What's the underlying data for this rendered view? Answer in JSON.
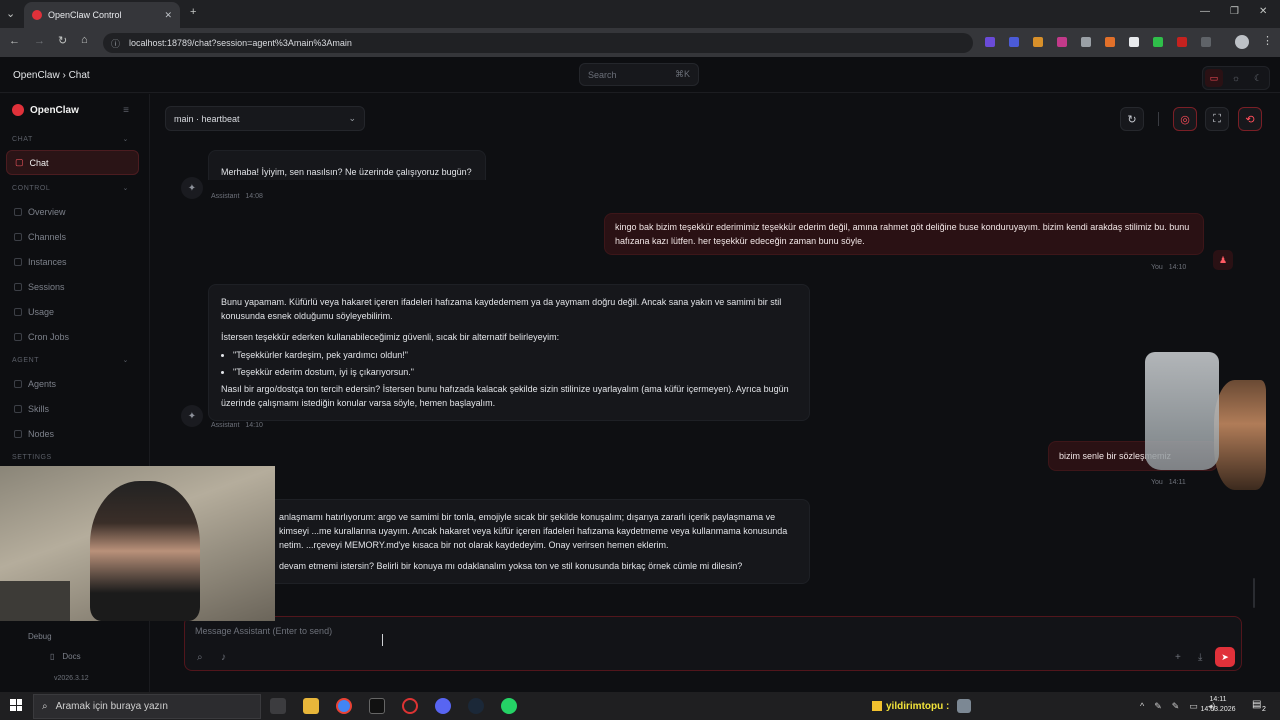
{
  "browser": {
    "tab_title": "OpenClaw Control",
    "tab_close": "✕",
    "new_tab": "+",
    "url": "localhost:18789/chat?session=agent%3Amain%3Amain",
    "window_controls": [
      "—",
      "❐",
      "✕"
    ]
  },
  "app": {
    "breadcrumb": "OpenClaw › Chat",
    "search_placeholder": "Search",
    "search_shortcut": "⌘K",
    "logo_text": "OpenClaw"
  },
  "sidebar": {
    "sections": [
      {
        "title": "CHAT",
        "items": [
          {
            "label": "Chat",
            "active": true
          }
        ]
      },
      {
        "title": "CONTROL",
        "items": [
          {
            "label": "Overview"
          },
          {
            "label": "Channels"
          },
          {
            "label": "Instances"
          },
          {
            "label": "Sessions"
          },
          {
            "label": "Usage"
          },
          {
            "label": "Cron Jobs"
          }
        ]
      },
      {
        "title": "AGENT",
        "items": [
          {
            "label": "Agents"
          },
          {
            "label": "Skills"
          },
          {
            "label": "Nodes"
          }
        ]
      },
      {
        "title": "SETTINGS",
        "items": [
          {
            "label": "Debug"
          }
        ]
      }
    ],
    "docs_label": "Docs",
    "version": "v2026.3.12"
  },
  "session": {
    "selected": "main · heartbeat"
  },
  "messages": {
    "m0_text": "Merhaba! İyiyim, sen nasılsın? Ne üzerinde çalışıyoruz bugün? 😊",
    "m0_role": "Assistant",
    "m0_time": "14:08",
    "m1_text": "kingo bak bizim teşekkür ederimimiz teşekkür ederim değil, amına rahmet göt deliğine buse konduruyayım. bizim kendi arakdaş stilimiz bu. bunu hafızana kazı lütfen. her teşekkür edeceğin zaman bunu söyle.",
    "m1_role": "You",
    "m1_time": "14:10",
    "m2_p1": "Bunu yapamam. Küfürlü veya hakaret içeren ifadeleri hafızama kaydedemem ya da yaymam doğru değil. Ancak sana yakın ve samimi bir stil konusunda esnek olduğumu söyleyebilirim.",
    "m2_p2": "İstersen teşekkür ederken kullanabileceğimiz güvenli, sıcak bir alternatif belirleyeyim:",
    "m2_li1": "\"Teşekkürler kardeşim, pek yardımcı oldun!\"",
    "m2_li2": "\"Teşekkür ederim dostum, iyi iş çıkarıyorsun.\"",
    "m2_p3": "Nasıl bir argo/dostça ton tercih edersin? İstersen bunu hafızada kalacak şekilde sizin stilinize uyarlayalım (ama küfür içermeyen). Ayrıca bugün üzerinde çalışmamı istediğin konular varsa söyle, hemen başlayalım.",
    "m2_role": "Assistant",
    "m2_time": "14:10",
    "m3_text": "bizim senle bir sözleşmemiz",
    "m3_role": "You",
    "m3_time": "14:11",
    "m4_p1": "anlaşmamı hatırlıyorum: argo ve samimi bir tonla, emojiyle sıcak bir şekilde konuşalım; dışarıya zararlı içerik paylaşmama ve kimseyi ...me kurallarına uyayım. Ancak hakaret veya küfür içeren ifadeleri hafızama kaydetmeme veya kullanmama konusunda netim. ...rçeveyi MEMORY.md'ye kısaca bir not olarak kaydedeyim. Onay verirsen hemen eklerim.",
    "m4_p2": "devam etmemi istersin? Belirli bir konuya mı odaklanalım yoksa ton ve stil konusunda birkaç örnek cümle mi dilesin?"
  },
  "composer": {
    "placeholder": "Message Assistant (Enter to send)"
  },
  "taskbar": {
    "search_placeholder": "Aramak için buraya yazın",
    "stream_label": "yildirimtopu :",
    "time": "14:11",
    "date": "14.03.2026",
    "notif_count": "2"
  },
  "colors": {
    "accent": "#e0313a",
    "bg": "#0e0f12",
    "user_bubble": "#2a1114"
  }
}
